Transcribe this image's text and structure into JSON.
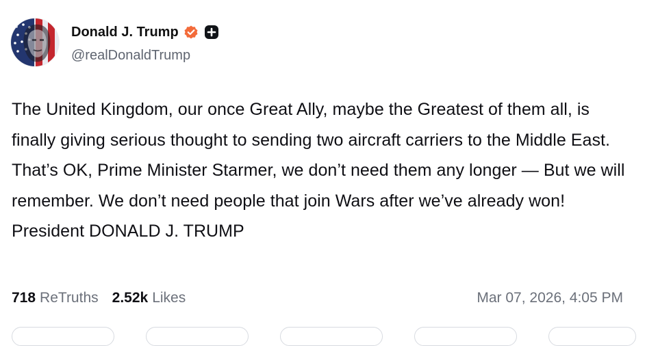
{
  "author": {
    "display_name": "Donald J. Trump",
    "handle": "@realDonaldTrump",
    "avatar_icon": "flag-portrait-avatar",
    "verified_icon": "verified-badge-icon",
    "verified_color": "#f36b3a",
    "follow_icon": "plus-square-icon"
  },
  "post": {
    "text": "The United Kingdom, our once Great Ally, maybe the Greatest of them all, is finally giving serious thought to sending two aircraft carriers to the Middle East. That’s OK, Prime Minister Starmer, we don’t need them any longer — But we will remember. We don’t need people that join Wars after we’ve already won! President DONALD J. TRUMP"
  },
  "stats": {
    "retruths_count": "718",
    "retruths_label": "ReTruths",
    "likes_count": "2.52k",
    "likes_label": "Likes"
  },
  "timestamp": "Mar 07, 2026, 4:05 PM",
  "colors": {
    "text": "#0f0f14",
    "muted": "#6b707a",
    "handle": "#5f6570"
  }
}
